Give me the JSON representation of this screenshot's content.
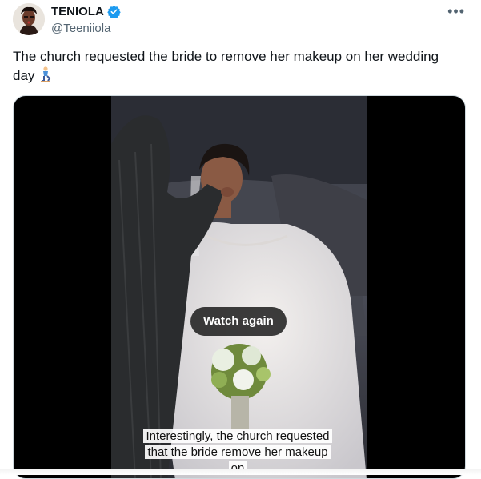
{
  "author": {
    "display_name": "TENIOLA",
    "handle": "@Teeniiola",
    "verified": true
  },
  "more_icon": "•••",
  "tweet": {
    "text": "The church requested the bride to remove her makeup on her wedding day",
    "emoji": "kneeling-person-emoji"
  },
  "media": {
    "watch_again_label": "Watch again",
    "caption": "Interestingly, the church requested that the bride remove her makeup on"
  },
  "colors": {
    "verified": "#1d9bf0",
    "secondary_text": "#536471",
    "primary_text": "#0f1419"
  }
}
